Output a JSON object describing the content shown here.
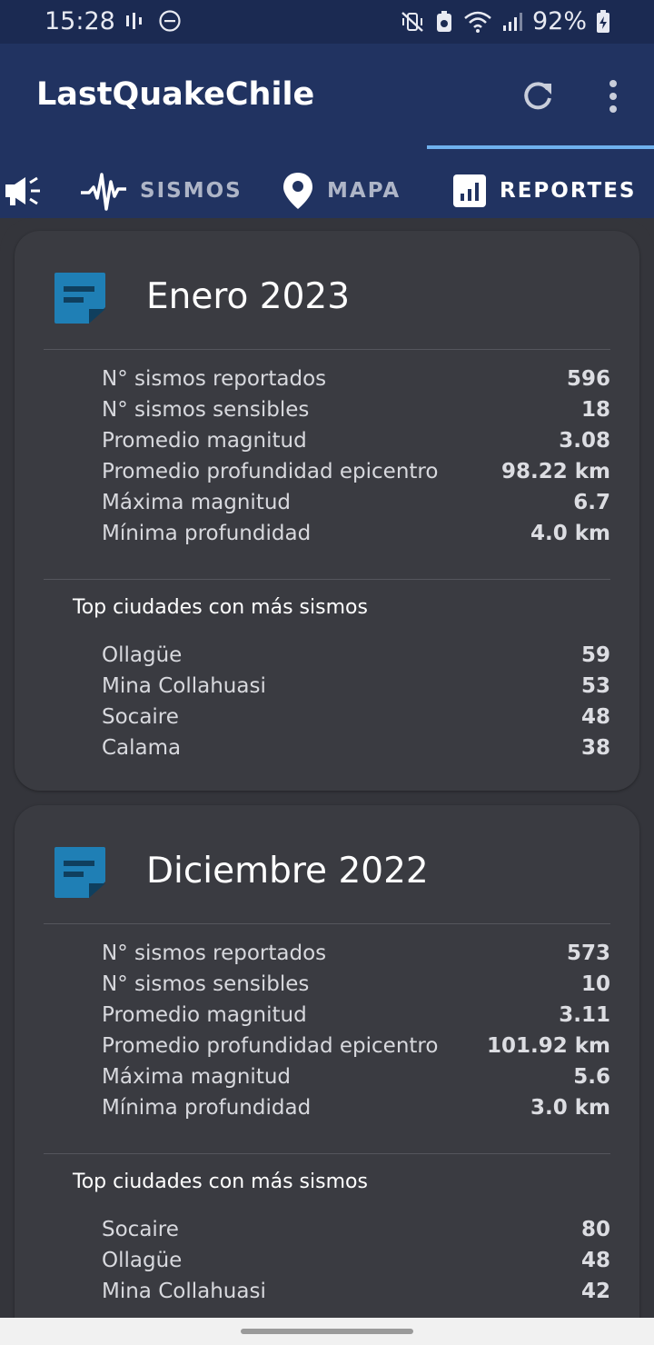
{
  "status_bar": {
    "time": "15:28",
    "battery": "92%",
    "icons": [
      "network-activity-icon",
      "do-not-disturb-icon",
      "mute-vibrate-icon",
      "data-saver-icon",
      "wifi-icon",
      "signal-icon",
      "battery-charging-icon"
    ]
  },
  "app": {
    "title": "LastQuakeChile",
    "actions": [
      "refresh-icon",
      "overflow-menu-icon"
    ]
  },
  "tabs": [
    {
      "label": "",
      "icon": "megaphone-icon",
      "active": false
    },
    {
      "label": "SISMOS",
      "icon": "seismograph-icon",
      "active": false
    },
    {
      "label": "MAPA",
      "icon": "map-pin-icon",
      "active": false
    },
    {
      "label": "REPORTES",
      "icon": "report-chart-icon",
      "active": true
    }
  ],
  "reports": [
    {
      "title": "Enero 2023",
      "stats": [
        {
          "label": "N° sismos reportados",
          "value": "596"
        },
        {
          "label": "N° sismos sensibles",
          "value": "18"
        },
        {
          "label": "Promedio magnitud",
          "value": "3.08"
        },
        {
          "label": "Promedio profundidad epicentro",
          "value": "98.22 km"
        },
        {
          "label": "Máxima magnitud",
          "value": "6.7"
        },
        {
          "label": "Mínima profundidad",
          "value": "4.0 km"
        }
      ],
      "top_title": "Top ciudades con más sismos",
      "top_cities": [
        {
          "name": "Ollagüe",
          "count": "59"
        },
        {
          "name": "Mina Collahuasi",
          "count": "53"
        },
        {
          "name": "Socaire",
          "count": "48"
        },
        {
          "name": "Calama",
          "count": "38"
        }
      ]
    },
    {
      "title": "Diciembre 2022",
      "stats": [
        {
          "label": "N° sismos reportados",
          "value": "573"
        },
        {
          "label": "N° sismos sensibles",
          "value": "10"
        },
        {
          "label": "Promedio magnitud",
          "value": "3.11"
        },
        {
          "label": "Promedio profundidad epicentro",
          "value": "101.92 km"
        },
        {
          "label": "Máxima magnitud",
          "value": "5.6"
        },
        {
          "label": "Mínima profundidad",
          "value": "3.0 km"
        }
      ],
      "top_title": "Top ciudades con más sismos",
      "top_cities": [
        {
          "name": "Socaire",
          "count": "80"
        },
        {
          "name": "Ollagüe",
          "count": "48"
        },
        {
          "name": "Mina Collahuasi",
          "count": "42"
        }
      ]
    }
  ],
  "colors": {
    "status_bar": "#1b2a52",
    "app_bar": "#213361",
    "tab_indicator": "#6fb1ee",
    "background": "#34353b",
    "card": "#3a3b41",
    "report_icon": "#1f7fb5"
  }
}
